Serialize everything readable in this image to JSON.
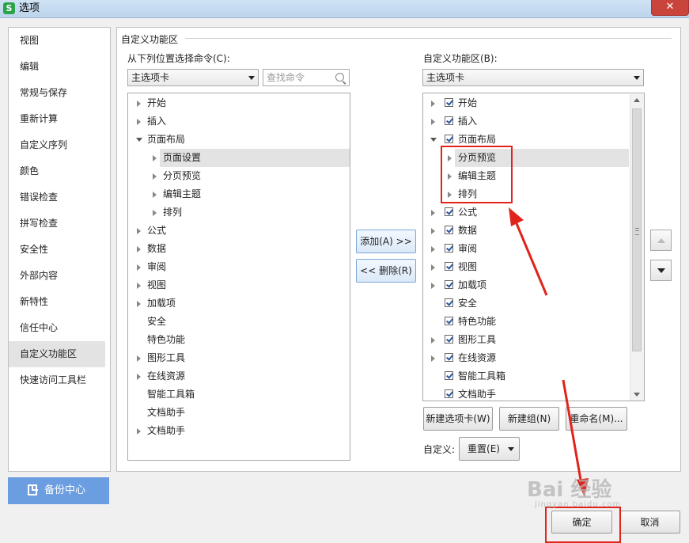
{
  "window": {
    "title": "选项",
    "app_icon": "S",
    "close_glyph": "✕"
  },
  "sidebar": {
    "items": [
      {
        "label": "视图"
      },
      {
        "label": "编辑"
      },
      {
        "label": "常规与保存"
      },
      {
        "label": "重新计算"
      },
      {
        "label": "自定义序列"
      },
      {
        "label": "颜色"
      },
      {
        "label": "错误检查"
      },
      {
        "label": "拼写检查"
      },
      {
        "label": "安全性"
      },
      {
        "label": "外部内容"
      },
      {
        "label": "新特性"
      },
      {
        "label": "信任中心"
      },
      {
        "label": "自定义功能区",
        "active": true
      },
      {
        "label": "快速访问工具栏"
      }
    ],
    "backup_label": "备份中心"
  },
  "main": {
    "group_title": "自定义功能区",
    "left": {
      "label": "从下列位置选择命令(C):",
      "combo_value": "主选项卡",
      "search_placeholder": "查找命令",
      "items": [
        {
          "label": "开始",
          "expander": "right"
        },
        {
          "label": "插入",
          "expander": "right"
        },
        {
          "label": "页面布局",
          "expander": "down"
        },
        {
          "label": "页面设置",
          "expander": "right",
          "child": true,
          "selected": true
        },
        {
          "label": "分页预览",
          "expander": "right",
          "child": true
        },
        {
          "label": "编辑主题",
          "expander": "right",
          "child": true
        },
        {
          "label": "排列",
          "expander": "right",
          "child": true
        },
        {
          "label": "公式",
          "expander": "right"
        },
        {
          "label": "数据",
          "expander": "right"
        },
        {
          "label": "审阅",
          "expander": "right"
        },
        {
          "label": "视图",
          "expander": "right"
        },
        {
          "label": "加载项",
          "expander": "right"
        },
        {
          "label": "安全",
          "expander": "none"
        },
        {
          "label": "特色功能",
          "expander": "none"
        },
        {
          "label": "图形工具",
          "expander": "right"
        },
        {
          "label": "在线资源",
          "expander": "right"
        },
        {
          "label": "智能工具箱",
          "expander": "none"
        },
        {
          "label": "文档助手",
          "expander": "none"
        },
        {
          "label": "文档助手",
          "expander": "right"
        }
      ]
    },
    "add_label": "添加(A) >>",
    "remove_label": "<< 删除(R)",
    "right": {
      "label": "自定义功能区(B):",
      "combo_value": "主选项卡",
      "items": [
        {
          "label": "开始",
          "expander": "right",
          "checked": true
        },
        {
          "label": "插入",
          "expander": "right",
          "checked": true
        },
        {
          "label": "页面布局",
          "expander": "down",
          "checked": true
        },
        {
          "label": "分页预览",
          "expander": "right",
          "child": true,
          "selected": true
        },
        {
          "label": "编辑主题",
          "expander": "right",
          "child": true
        },
        {
          "label": "排列",
          "expander": "right",
          "child": true
        },
        {
          "label": "公式",
          "expander": "right",
          "checked": true
        },
        {
          "label": "数据",
          "expander": "right",
          "checked": true
        },
        {
          "label": "审阅",
          "expander": "right",
          "checked": true
        },
        {
          "label": "视图",
          "expander": "right",
          "checked": true
        },
        {
          "label": "加载项",
          "expander": "right",
          "checked": true
        },
        {
          "label": "安全",
          "expander": "none",
          "checked": true
        },
        {
          "label": "特色功能",
          "expander": "none",
          "checked": true
        },
        {
          "label": "图形工具",
          "expander": "right",
          "checked": true
        },
        {
          "label": "在线资源",
          "expander": "right",
          "checked": true
        },
        {
          "label": "智能工具箱",
          "expander": "none",
          "checked": true
        },
        {
          "label": "文档助手",
          "expander": "none",
          "checked": true
        }
      ],
      "new_tab_label": "新建选项卡(W)",
      "new_group_label": "新建组(N)",
      "rename_label": "重命名(M)...",
      "customize_label": "自定义:",
      "reset_label": "重置(E)"
    }
  },
  "footer": {
    "ok_label": "确定",
    "cancel_label": "取消"
  },
  "annotation": {
    "color": "#e0231b"
  },
  "watermark": {
    "text": "Bai 经验",
    "sub": "jingyan.baidu.com"
  }
}
